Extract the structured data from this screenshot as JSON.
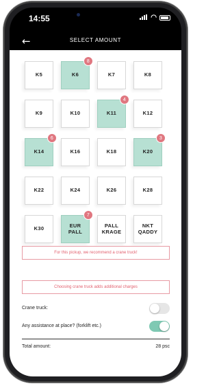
{
  "status": {
    "time": "14:55"
  },
  "header": {
    "title": "SELECT AMOUNT",
    "back_glyph": "←"
  },
  "grid": [
    {
      "label": "K5",
      "selected": false,
      "count": null
    },
    {
      "label": "K6",
      "selected": true,
      "count": "8"
    },
    {
      "label": "K7",
      "selected": false,
      "count": null
    },
    {
      "label": "K8",
      "selected": false,
      "count": null
    },
    {
      "label": "K9",
      "selected": false,
      "count": null
    },
    {
      "label": "K10",
      "selected": false,
      "count": null
    },
    {
      "label": "K11",
      "selected": true,
      "count": "4"
    },
    {
      "label": "K12",
      "selected": false,
      "count": null
    },
    {
      "label": "K14",
      "selected": true,
      "count": "6"
    },
    {
      "label": "K16",
      "selected": false,
      "count": null
    },
    {
      "label": "K18",
      "selected": false,
      "count": null
    },
    {
      "label": "K20",
      "selected": true,
      "count": "3"
    },
    {
      "label": "K22",
      "selected": false,
      "count": null
    },
    {
      "label": "K24",
      "selected": false,
      "count": null
    },
    {
      "label": "K26",
      "selected": false,
      "count": null
    },
    {
      "label": "K28",
      "selected": false,
      "count": null
    },
    {
      "label": "K30",
      "selected": false,
      "count": null
    },
    {
      "label": "EUR PALL",
      "selected": true,
      "count": "7"
    },
    {
      "label": "PALL KRAGE",
      "selected": false,
      "count": null
    },
    {
      "label": "NKT QADDY",
      "selected": false,
      "count": null
    }
  ],
  "notices": {
    "recommend": "For this pickup, we recommend a crane truck!",
    "charges": "Choosing crane truck adds additional charges"
  },
  "options": {
    "crane_label": "Crane truck:",
    "crane_on": false,
    "assistance_label": "Any assistance at place? (forklift etc.)",
    "assistance_on": true
  },
  "total": {
    "label": "Total amount:",
    "value": "28 psc"
  },
  "colors": {
    "selected": "#b7e0d3",
    "badge": "#e07780",
    "notice": "#e2606e",
    "toggle_on": "#7fc9b3"
  }
}
